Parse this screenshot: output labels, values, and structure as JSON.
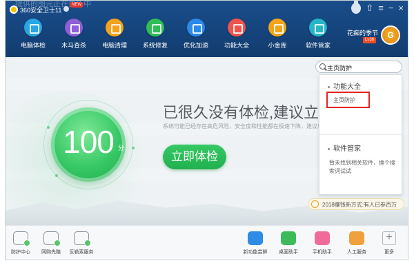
{
  "window": {
    "ghost_title": "提供的图元正在更新中",
    "app_name": "360安全卫士11",
    "new_badge": "NEW",
    "controls": [
      "medal",
      "shirt",
      "menu",
      "minimize",
      "close"
    ]
  },
  "nav": {
    "items": [
      {
        "label": "电脑体检",
        "icon": "monitor-check-icon",
        "color": "#2aa6e6"
      },
      {
        "label": "木马查杀",
        "icon": "trojan-horse-icon",
        "color": "#8e5fd6"
      },
      {
        "label": "电脑清理",
        "icon": "broom-icon",
        "color": "#f5a21c"
      },
      {
        "label": "系统修复",
        "icon": "shield-check-icon",
        "color": "#2fbf57"
      },
      {
        "label": "优化加速",
        "icon": "rocket-icon",
        "color": "#2b8ae8"
      },
      {
        "label": "功能大全",
        "icon": "grid-apps-icon",
        "color": "#f0534b"
      },
      {
        "label": "小金库",
        "icon": "coin-bag-icon",
        "color": "#f3a51a"
      },
      {
        "label": "软件管家",
        "icon": "app-store-icon",
        "color": "#26b6c8"
      }
    ]
  },
  "user": {
    "name": "花痴的季节",
    "vip_badge": "Lv38",
    "avatar_letter": "G"
  },
  "main": {
    "score": "100",
    "score_unit": "分",
    "headline": "已很久没有体检,建议立即体检",
    "subline": "系统可能已经存在高危风险，安全度和性能都在极速下降，建议您立即体检！",
    "check_button": "立即体检"
  },
  "search": {
    "query": "主页防护"
  },
  "dropdown": {
    "section1_title": "功能大全",
    "section1_result": "主页防护",
    "section2_title": "软件管家",
    "section2_empty": "暂未找到相关软件，换个搜索词试试"
  },
  "promo": {
    "text": "2018赚钱新方式:有人已参百万"
  },
  "bottom": {
    "left_tools": [
      {
        "label": "防护中心",
        "icon": "shield-status-icon"
      },
      {
        "label": "网购先赔",
        "icon": "cart-guarantee-icon"
      },
      {
        "label": "反勒索服务",
        "icon": "anti-ransom-icon"
      }
    ],
    "right_tools": [
      {
        "label": "新功能尝鲜",
        "icon": "new-feature-icon",
        "color": "#2e8be6"
      },
      {
        "label": "桌面助手",
        "icon": "desktop-assistant-icon",
        "color": "#3dbb5a"
      },
      {
        "label": "手机助手",
        "icon": "phone-assistant-icon",
        "color": "#f06b9a"
      },
      {
        "label": "人工服务",
        "icon": "customer-service-icon",
        "color": "#f0a03c"
      },
      {
        "label": "更多",
        "icon": "more-plus-icon"
      }
    ]
  }
}
